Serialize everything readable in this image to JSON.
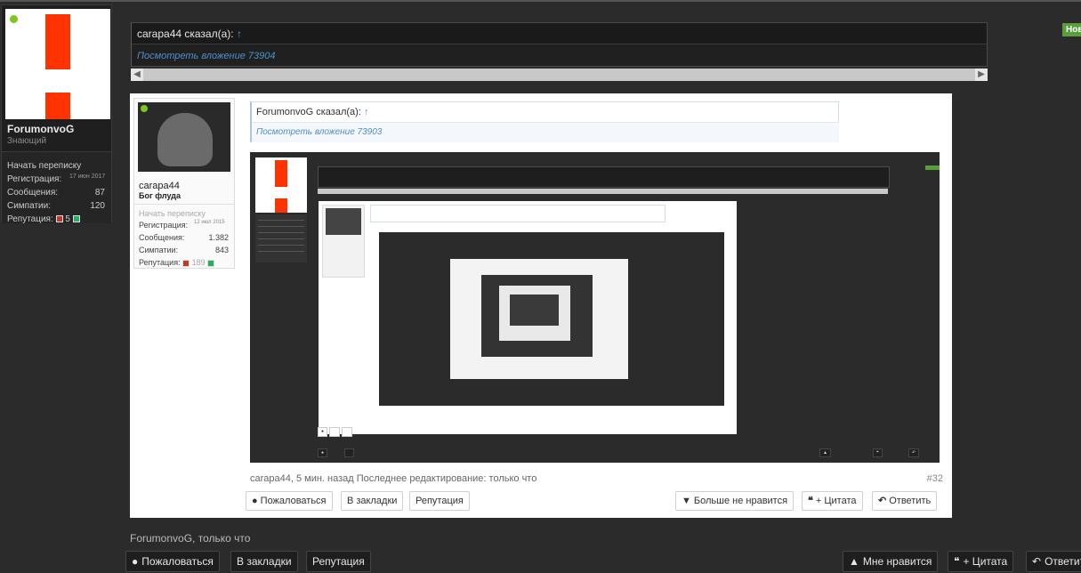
{
  "user": {
    "name": "ForumonvoG",
    "title": "Знающий",
    "start_conversation": "Начать переписку",
    "reg_label": "Регистрация:",
    "reg_value": "17 июн 2017",
    "posts_label": "Сообщения:",
    "posts_value": "87",
    "likes_label": "Симпатии:",
    "likes_value": "120",
    "rep_label": "Репутация:",
    "rep_value": "5"
  },
  "dark_quote": {
    "header": "carapa44 сказал(а):",
    "arrow": "↑",
    "link": "Посмотреть вложение 73904"
  },
  "notif_label": "Нов",
  "post": {
    "user": {
      "name": "carapa44",
      "title": "Бог флуда",
      "start_conversation": "Начать переписку",
      "reg_label": "Регистрация:",
      "reg_value": "12 июл 2015",
      "posts_label": "Сообщения:",
      "posts_value": "1.382",
      "likes_label": "Симпатии:",
      "likes_value": "843",
      "rep_label": "Репутация:",
      "rep_value": "189"
    },
    "quote": {
      "header": "ForumonvoG сказал(а):",
      "arrow": "↑",
      "link": "Посмотреть вложение 73903"
    },
    "meta": "carapa44, 5 мин. назад  Последнее редактирование: только что",
    "number": "#32",
    "buttons": {
      "report": "Пожаловаться",
      "bookmark": "В закладки",
      "reputation": "Репутация",
      "unlike": "Больше не нравится",
      "quote": "+ Цитата",
      "reply": "Ответить"
    }
  },
  "bottom": {
    "meta": "ForumonvoG, только что",
    "report": "Пожаловаться",
    "bookmark": "В закладки",
    "reputation": "Репутация",
    "like": "Мне нравится",
    "quote": "+ Цитата",
    "reply": "Ответить"
  },
  "icons": {
    "report": "alert-circle-icon",
    "like": "thumbs-up-icon",
    "unlike": "thumbs-down-icon",
    "quote": "quote-icon",
    "reply": "reply-icon"
  }
}
